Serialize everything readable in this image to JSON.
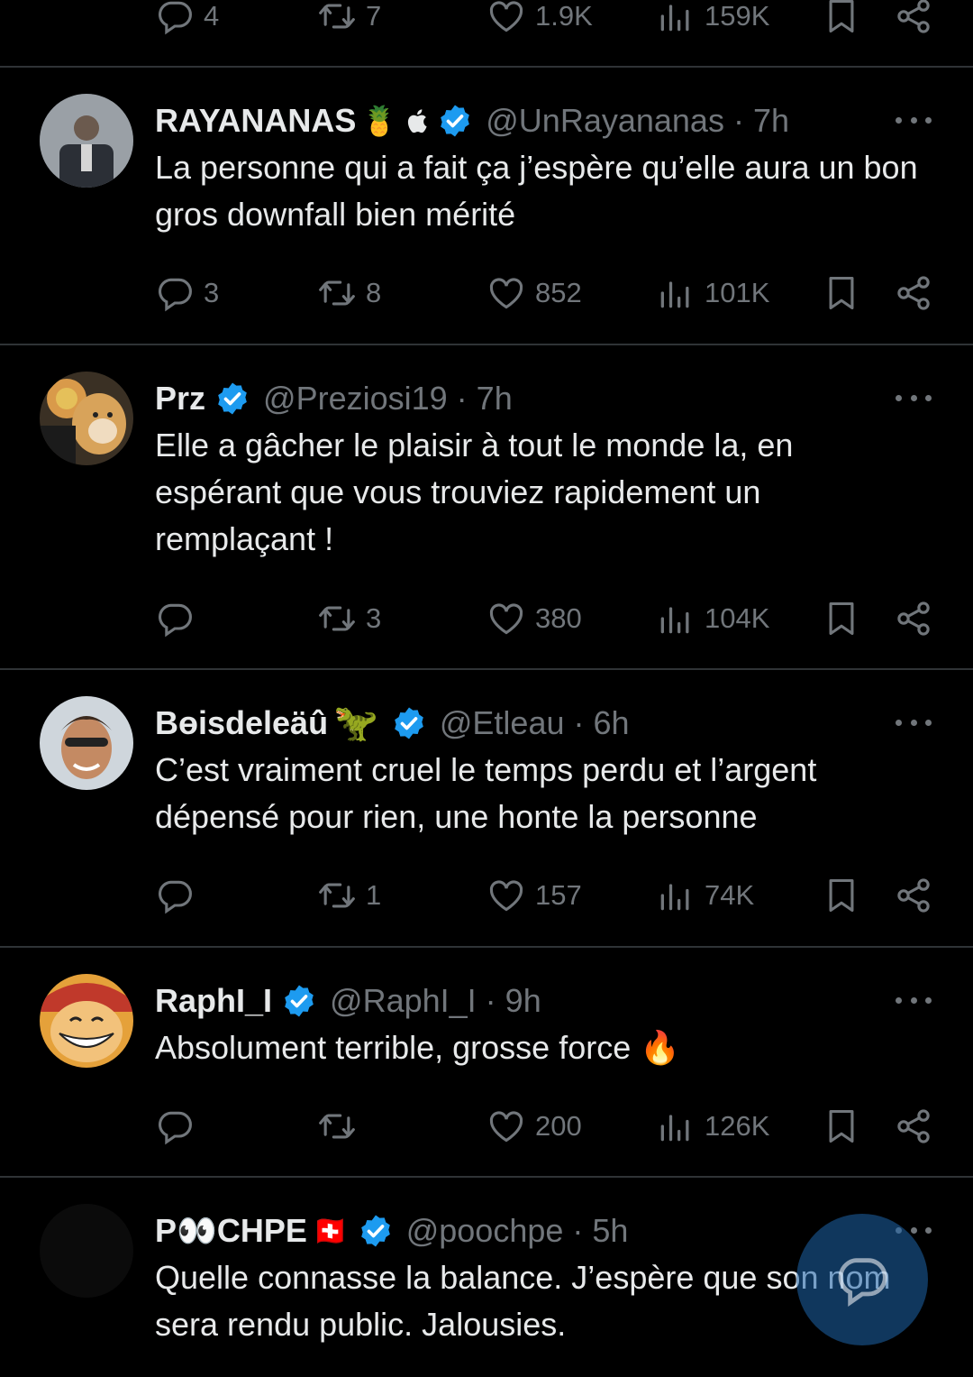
{
  "top_actions": {
    "reply": "4",
    "retweet": "7",
    "like": "1.9K",
    "views": "159K"
  },
  "tweets": [
    {
      "name": "RAYANANAS",
      "name_emoji": "🍍 ",
      "handle": "@UnRayananas",
      "dot": "·",
      "time": "7h",
      "text": "La personne qui a fait ça j’espère qu’elle aura un bon gros downfall bien mérité",
      "reply": "3",
      "retweet": "8",
      "like": "852",
      "views": "101K"
    },
    {
      "name": "Prz",
      "name_emoji": "",
      "handle": "@Preziosi19",
      "dot": "·",
      "time": "7h",
      "text": "Elle a gâcher le plaisir à tout le monde la, en espérant que vous trouviez rapidement un remplaçant !",
      "reply": "",
      "retweet": "3",
      "like": "380",
      "views": "104K"
    },
    {
      "name": "Bɵisdeleäû",
      "name_emoji": "🦖",
      "handle": "@Etleau",
      "dot": "·",
      "time": "6h",
      "text": "C’est vraiment cruel le temps perdu et l’argent dépensé pour rien, une honte la personne",
      "reply": "",
      "retweet": "1",
      "like": "157",
      "views": "74K"
    },
    {
      "name": "RaphI_I",
      "name_emoji": "",
      "handle": "@RaphI_I",
      "dot": "·",
      "time": "9h",
      "text": "Absolument terrible, grosse force 🔥",
      "reply": "",
      "retweet": "",
      "like": "200",
      "views": "126K"
    },
    {
      "name": "P👀CHPE",
      "name_emoji": "🇨🇭",
      "handle": "@poochpe",
      "dot": "·",
      "time": "5h",
      "text": "Quelle connasse la balance. J’espère que son nom sera rendu public. Jalousies."
    }
  ],
  "colors": {
    "background": "#000000",
    "text": "#e7e9ea",
    "muted": "#71767b",
    "verified": "#1d9bf0",
    "separator": "#2f3336"
  },
  "icons": [
    "reply-icon",
    "retweet-icon",
    "like-icon",
    "views-icon",
    "bookmark-icon",
    "share-icon",
    "verified-icon",
    "more-icon",
    "compose-reply-icon"
  ]
}
